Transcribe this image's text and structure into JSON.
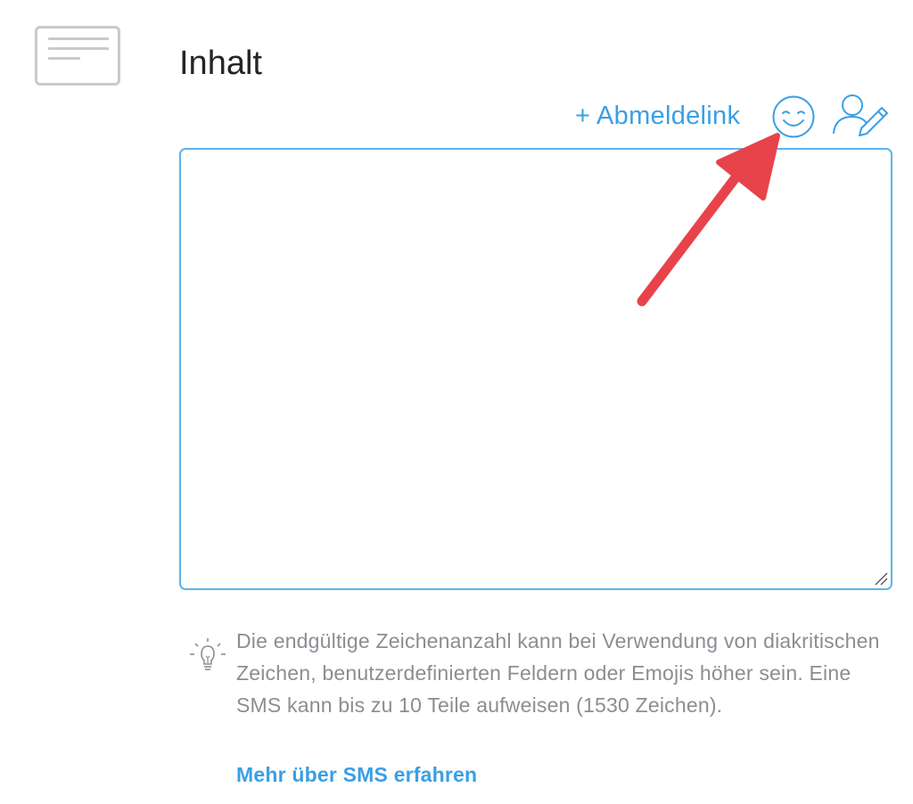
{
  "section": {
    "icon": "text-content-icon",
    "title": "Inhalt"
  },
  "toolbar": {
    "unsubscribe_link": "+ Abmeldelink",
    "emoji_icon": "smiley-icon",
    "personalize_icon": "user-edit-icon"
  },
  "editor": {
    "value": "",
    "placeholder": ""
  },
  "hint": {
    "icon": "lightbulb-icon",
    "text": "Die endgültige Zeichenanzahl kann bei Verwendung von diakritischen Zeichen, benutzerdefinierten Feldern oder Emojis höher sein. Eine SMS kann bis zu 10 Teile aufweisen (1530 Zeichen).",
    "link": "Mehr über SMS erfahren"
  },
  "colors": {
    "accent": "#3a9fe5",
    "border": "#5db4ec",
    "annotation_arrow": "#e8434b",
    "muted_text": "#8a8e93"
  }
}
